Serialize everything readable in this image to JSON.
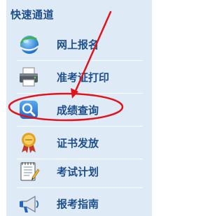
{
  "panel": {
    "title": "快速通道"
  },
  "items": [
    {
      "label": "网上报名",
      "icon": "globe-icon"
    },
    {
      "label": "准考证打印",
      "icon": "printer-icon"
    },
    {
      "label": "成绩查询",
      "icon": "magnifier-icon"
    },
    {
      "label": "证书发放",
      "icon": "medal-icon"
    },
    {
      "label": "考试计划",
      "icon": "notepad-icon"
    },
    {
      "label": "报考指南",
      "icon": "megaphone-icon"
    }
  ],
  "colors": {
    "panel_bg": "#deeaf6",
    "text": "#1e4f8c",
    "annotation": "#e0141c"
  }
}
